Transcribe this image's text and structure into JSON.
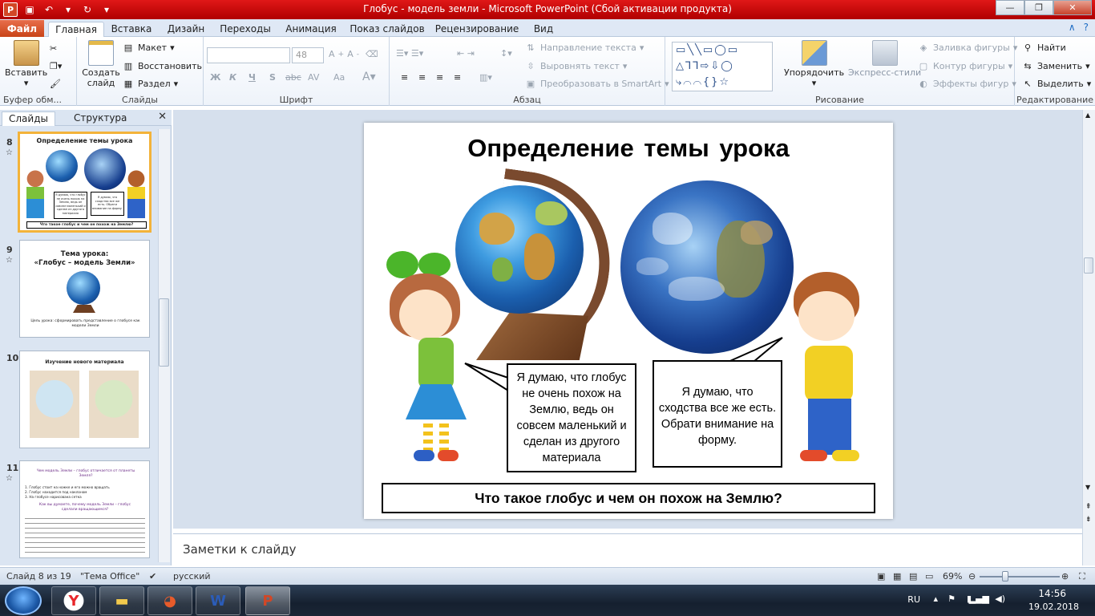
{
  "window": {
    "title": "Глобус - модель земли  -  Microsoft PowerPoint (Сбой активации продукта)",
    "app_icon": "P",
    "qat": [
      "save-icon",
      "undo-icon",
      "redo-icon",
      "customize-icon"
    ],
    "controls": {
      "minimize": "—",
      "maximize": "❐",
      "close": "✕"
    }
  },
  "ribbon_tabs": {
    "file": "Файл",
    "items": [
      "Главная",
      "Вставка",
      "Дизайн",
      "Переходы",
      "Анимация",
      "Показ слайдов",
      "Рецензирование",
      "Вид"
    ],
    "active": "Главная"
  },
  "ribbon": {
    "clipboard": {
      "label": "Буфер обм...",
      "paste": "Вставить"
    },
    "slides": {
      "label": "Слайды",
      "new_slide": "Создать слайд",
      "layout": "Макет",
      "reset": "Восстановить",
      "section": "Раздел"
    },
    "font": {
      "label": "Шрифт",
      "font_name": "",
      "font_size": "48",
      "bold": "Ж",
      "italic": "К",
      "underline": "Ч",
      "shadow": "S",
      "strike": "abc",
      "spacing": "AV",
      "case": "Aa"
    },
    "paragraph": {
      "label": "Абзац",
      "text_direction": "Направление текста",
      "align_text": "Выровнять текст",
      "smartart": "Преобразовать в SmartArt"
    },
    "drawing": {
      "label": "Рисование",
      "arrange": "Упорядочить",
      "quick_styles": "Экспресс-стили",
      "fill": "Заливка фигуры",
      "outline": "Контур фигуры",
      "effects": "Эффекты фигур"
    },
    "editing": {
      "label": "Редактирование",
      "find": "Найти",
      "replace": "Заменить",
      "select": "Выделить"
    }
  },
  "left_pane": {
    "tabs": [
      "Слайды",
      "Структура"
    ],
    "thumbnails": [
      {
        "num": "8",
        "title": "Определение темы урока",
        "selected": true,
        "bubble1": "Я думаю, что глобус не очень похож на Землю, ведь он совсем маленький и сделан из другого материала",
        "bubble2": "Я думаю, что сходства все же есть. Обрати внимание на форму.",
        "question": "Что такое глобус и чем он похож на Землю?"
      },
      {
        "num": "9",
        "title": "Тема урока:\n«Глобус – модель Земли»",
        "caption": "Цель урока: сформировать представление о глобусе как модели Земли"
      },
      {
        "num": "10",
        "title": "Изучение нового материала"
      },
      {
        "num": "11",
        "title": "Чем модель Земли – глобус отличается от планеты Земля?",
        "lines": [
          "1. Глобус стоит на ножке и его можно вращать",
          "2. Глобус находится под наклоном",
          "3. На глобусе нарисована сетка"
        ],
        "subtitle": "Как вы думаете, почему модель Земли – глобус сделали вращающимся?"
      }
    ]
  },
  "slide": {
    "title": "Определение  темы урока",
    "bubble1": "Я думаю, что глобус не очень похож на Землю, ведь он совсем маленький и сделан из другого материала",
    "bubble2": "Я думаю, что сходства все же есть. Обрати внимание на форму.",
    "question": "Что такое глобус и чем он похож на Землю?"
  },
  "notes": {
    "placeholder": "Заметки к слайду"
  },
  "status": {
    "slide_info": "Слайд 8 из 19",
    "theme": "\"Тема Office\"",
    "language": "русский",
    "zoom": "69%",
    "zoom_value": 0.69
  },
  "taskbar": {
    "lang": "RU",
    "time": "14:56",
    "date": "19.02.2018"
  }
}
